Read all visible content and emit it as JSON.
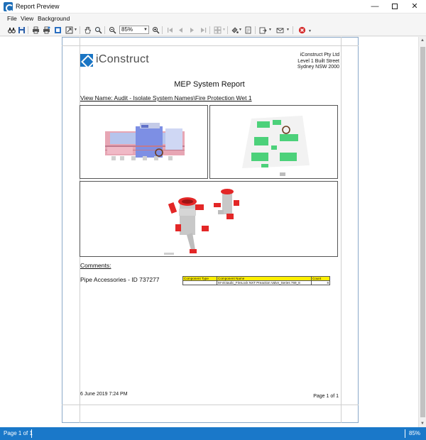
{
  "window": {
    "title": "Report Preview",
    "minimize_glyph": "—",
    "close_glyph": "✕"
  },
  "menu": {
    "items": [
      "File",
      "View",
      "Background"
    ]
  },
  "toolbar": {
    "zoom_value": "85%",
    "icons": [
      "find-icon",
      "save-icon",
      "print-icon",
      "quick-print-icon",
      "page-setup-icon",
      "scale-icon",
      "hand-tool-icon",
      "magnifier-icon",
      "zoom-out-icon",
      "zoom-in-icon",
      "first-page-icon",
      "previous-page-icon",
      "next-page-icon",
      "last-page-icon",
      "multiple-pages-icon",
      "background-color-icon",
      "watermark-icon",
      "export-icon",
      "send-email-icon",
      "close-preview-icon"
    ]
  },
  "report": {
    "logo_text": "iConstruct",
    "company_lines": [
      "iConstruct Pty Ltd",
      "Level 1 Built Street",
      "Sydney NSW 2000"
    ],
    "title": "MEP System Report",
    "view_name": "View Name: Audit - Isolate System Names\\Fire Protection Wet 1",
    "comments_label": "Comments:",
    "item_label": "Pipe Accessories - ID 737277",
    "table": {
      "headers": [
        "Component Type",
        "Component Name",
        "Count"
      ],
      "rows": [
        [
          "",
          "M-Victaulic_FireLock NXT Preaction Valve_Series 769_8",
          "8"
        ]
      ]
    },
    "date": "6 June 2019 7:24 PM",
    "page_number": "Page 1 of 1"
  },
  "status": {
    "page": "Page 1 of 1",
    "zoom": "85%"
  },
  "colors": {
    "accent": "#1a78c9",
    "highlight": "#ffef00",
    "pipe_red": "#e32727",
    "pipe_grey": "#c8c8c8",
    "fire_green": "#4cd17a"
  }
}
